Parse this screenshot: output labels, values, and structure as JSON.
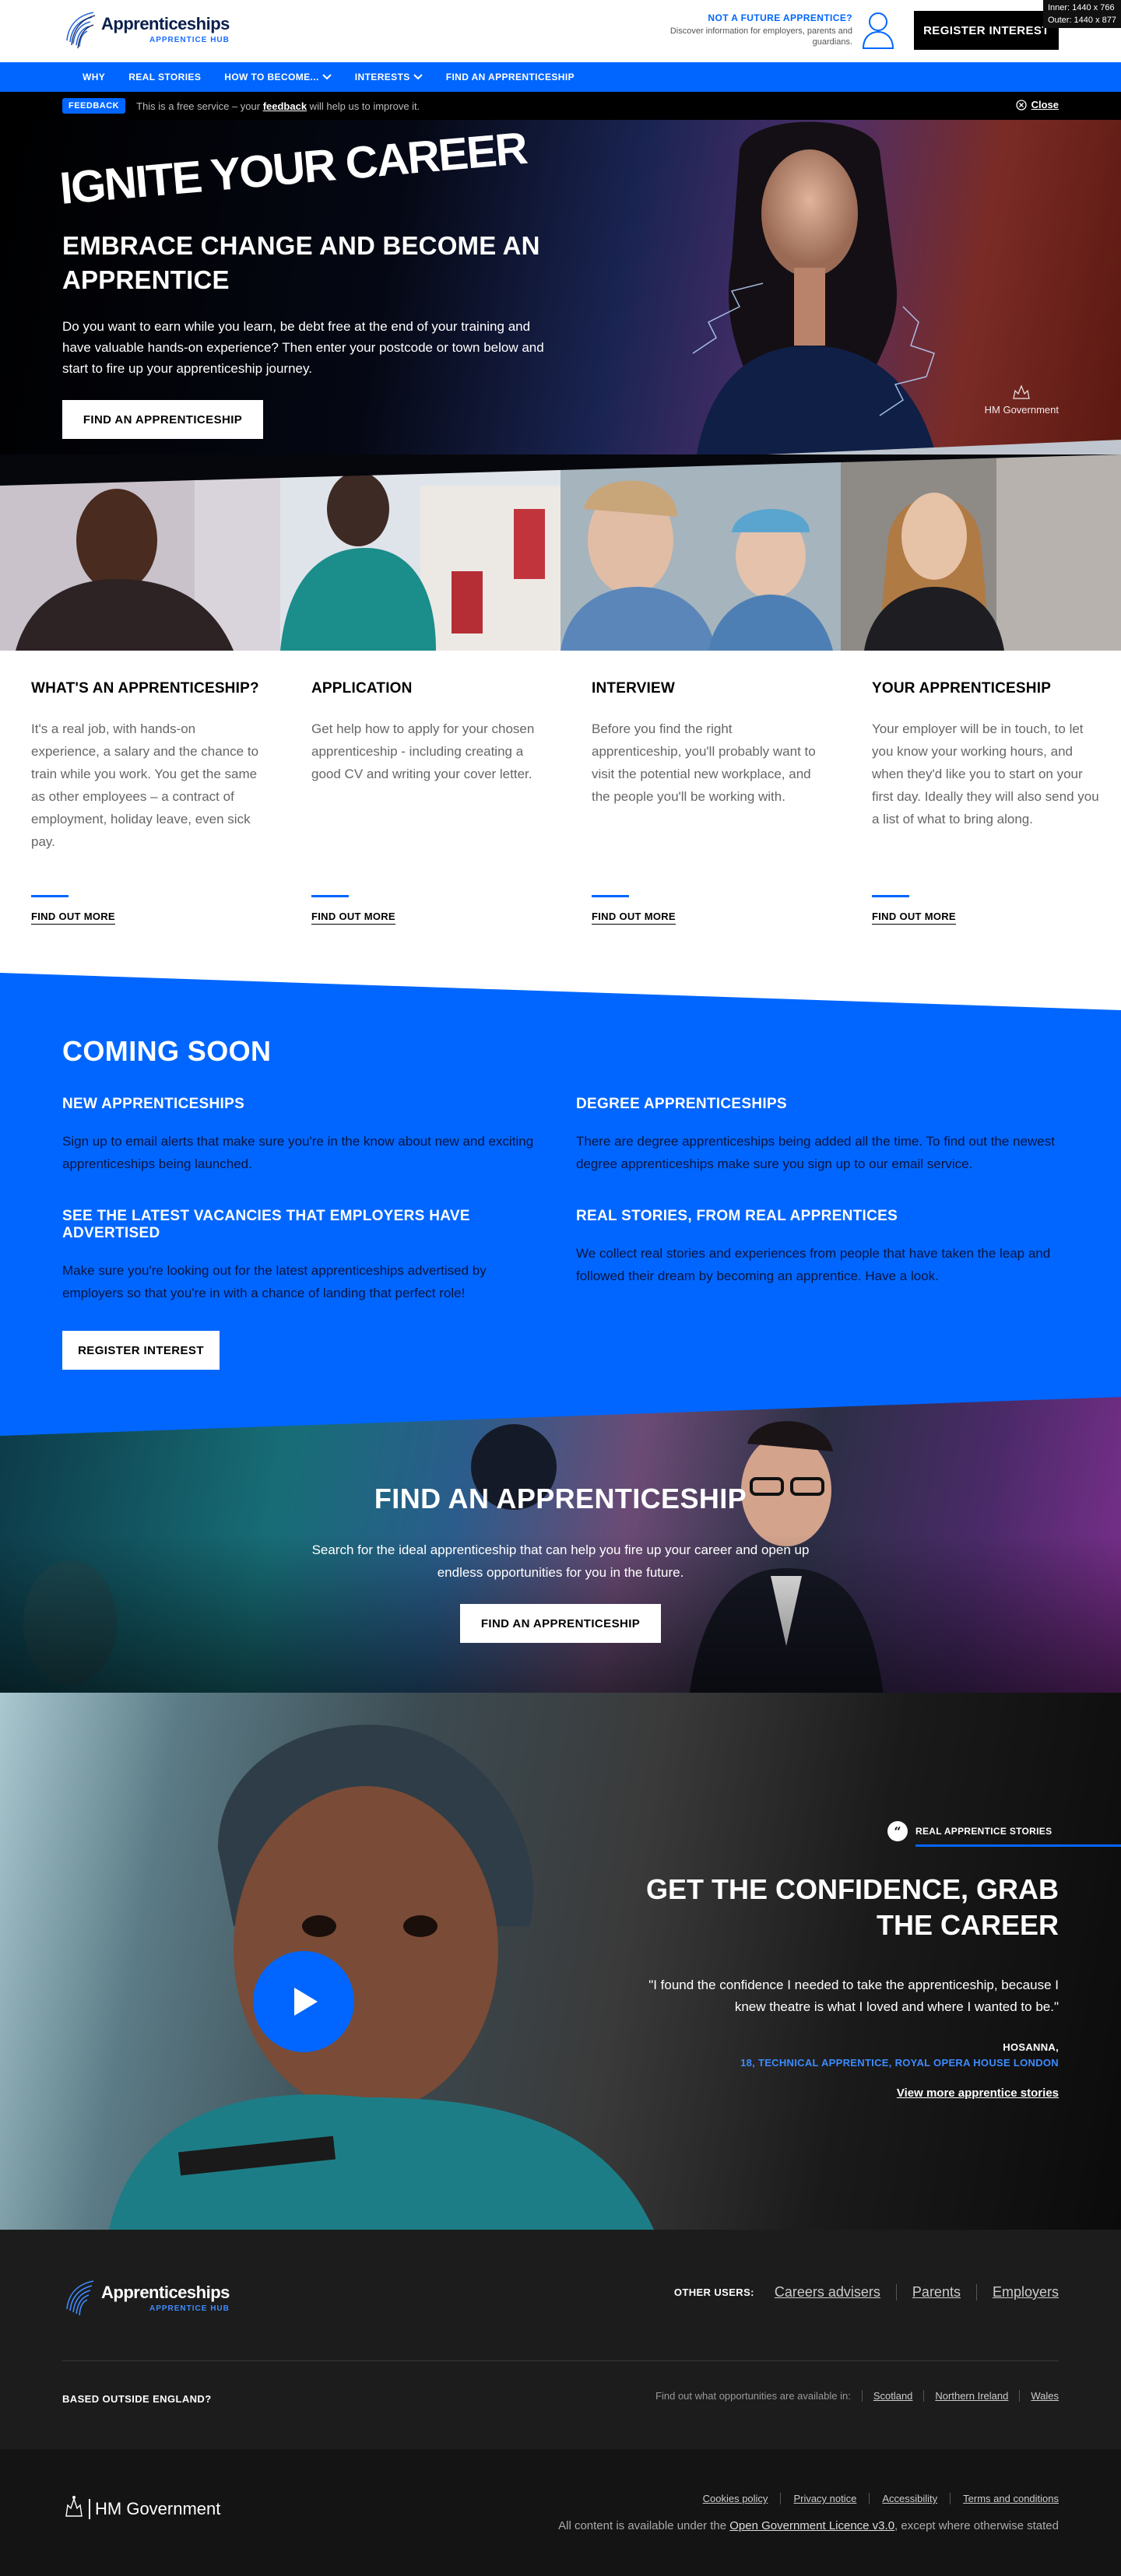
{
  "badge": {
    "inner": "Inner: 1440 x 766",
    "outer": "Outer: 1440 x 877"
  },
  "header": {
    "logo_title": "Apprenticeships",
    "logo_sub": "APPRENTICE HUB",
    "not_future_title": "NOT A FUTURE APPRENTICE?",
    "not_future_sub": "Discover information for employers, parents and guardians.",
    "register_label": "REGISTER INTEREST"
  },
  "nav": {
    "items": [
      {
        "label": "WHY"
      },
      {
        "label": "REAL STORIES"
      },
      {
        "label": "HOW TO BECOME..."
      },
      {
        "label": "INTERESTS"
      },
      {
        "label": "FIND AN APPRENTICESHIP"
      }
    ]
  },
  "feedback": {
    "badge": "FEEDBACK",
    "text_before": "This is a free service – your ",
    "link": "feedback",
    "text_after": " will help us to improve it.",
    "close": "Close"
  },
  "hero": {
    "ignite": "IGNITE YOUR CAREER",
    "subtitle": "EMBRACE CHANGE AND BECOME AN APPRENTICE",
    "body": "Do you want to earn while you learn, be debt free at the end of your training and have valuable hands-on experience? Then enter your postcode or town below and start to fire up your apprenticeship journey.",
    "button": "FIND AN APPRENTICESHIP",
    "gov": "HM Government"
  },
  "steps": [
    {
      "title": "WHAT'S AN APPRENTICESHIP?",
      "body": "It's a real job, with hands-on experience, a salary and the chance to train while you work. You get the same as other employees – a contract of employment, holiday leave, even sick pay.",
      "link": "FIND OUT MORE"
    },
    {
      "title": "APPLICATION",
      "body": "Get help how to apply for your chosen apprenticeship - including creating a good CV and writing your cover letter.",
      "link": "FIND OUT MORE"
    },
    {
      "title": "INTERVIEW",
      "body": "Before you find the right apprenticeship, you'll probably want to visit the potential new workplace, and the people you'll be working with.",
      "link": "FIND OUT MORE"
    },
    {
      "title": "YOUR APPRENTICESHIP",
      "body": "Your employer will be in touch, to let you know your working hours, and when they'd like you to start on your first day. Ideally they will also send you a list of what to bring along.",
      "link": "FIND OUT MORE"
    }
  ],
  "coming": {
    "title": "COMING SOON",
    "items": [
      {
        "title": "NEW APPRENTICESHIPS",
        "body": "Sign up to email alerts that make sure you're in the know about new and exciting apprenticeships being launched."
      },
      {
        "title": "DEGREE APPRENTICESHIPS",
        "body": "There are degree apprenticeships being added all the time. To find out the newest degree apprenticeships make sure you sign up to our email service."
      },
      {
        "title": "SEE THE LATEST VACANCIES THAT EMPLOYERS HAVE ADVERTISED",
        "body": "Make sure you're looking out for the latest apprenticeships advertised by employers so that you're in with a chance of landing that perfect role!"
      },
      {
        "title": "REAL STORIES, FROM REAL APPRENTICES",
        "body": "We collect real stories and experiences from people that have taken the leap and followed their dream by becoming an apprentice. Have a look."
      }
    ],
    "button": "REGISTER INTEREST"
  },
  "find": {
    "title": "FIND AN APPRENTICESHIP",
    "body": "Search for the ideal apprenticeship that can help you fire up your career and open up endless opportunities for you in the future.",
    "button": "FIND AN APPRENTICESHIP"
  },
  "story": {
    "tag": "REAL APPRENTICE STORIES",
    "title": "GET THE CONFIDENCE, GRAB THE CAREER",
    "quote": "\"I found the confidence I needed to take the apprenticeship, because I knew theatre is what I loved and where I wanted to be.\"",
    "name": "HOSANNA,",
    "role": "18, TECHNICAL APPRENTICE, ROYAL OPERA HOUSE LONDON",
    "more": "View more apprentice stories"
  },
  "footer": {
    "logo_title": "Apprenticeships",
    "logo_sub": "APPRENTICE HUB",
    "other_users_label": "OTHER USERS:",
    "other_users": [
      "Careers advisers",
      "Parents",
      "Employers"
    ],
    "based_label": "BASED OUTSIDE ENGLAND?",
    "regions_intro": "Find out what opportunities are available in:",
    "regions": [
      "Scotland",
      "Northern Ireland",
      "Wales"
    ],
    "legal": [
      "Cookies policy",
      "Privacy notice",
      "Accessibility",
      "Terms and conditions"
    ],
    "licence_before": "All content is available under the ",
    "licence_link": "Open Government Licence v3.0",
    "licence_after": ", except where otherwise stated",
    "hm_gov": "HM Government"
  },
  "colors": {
    "brand_blue": "#0066ff",
    "navy": "#0b1f4d",
    "dark": "#1c1c1c"
  }
}
